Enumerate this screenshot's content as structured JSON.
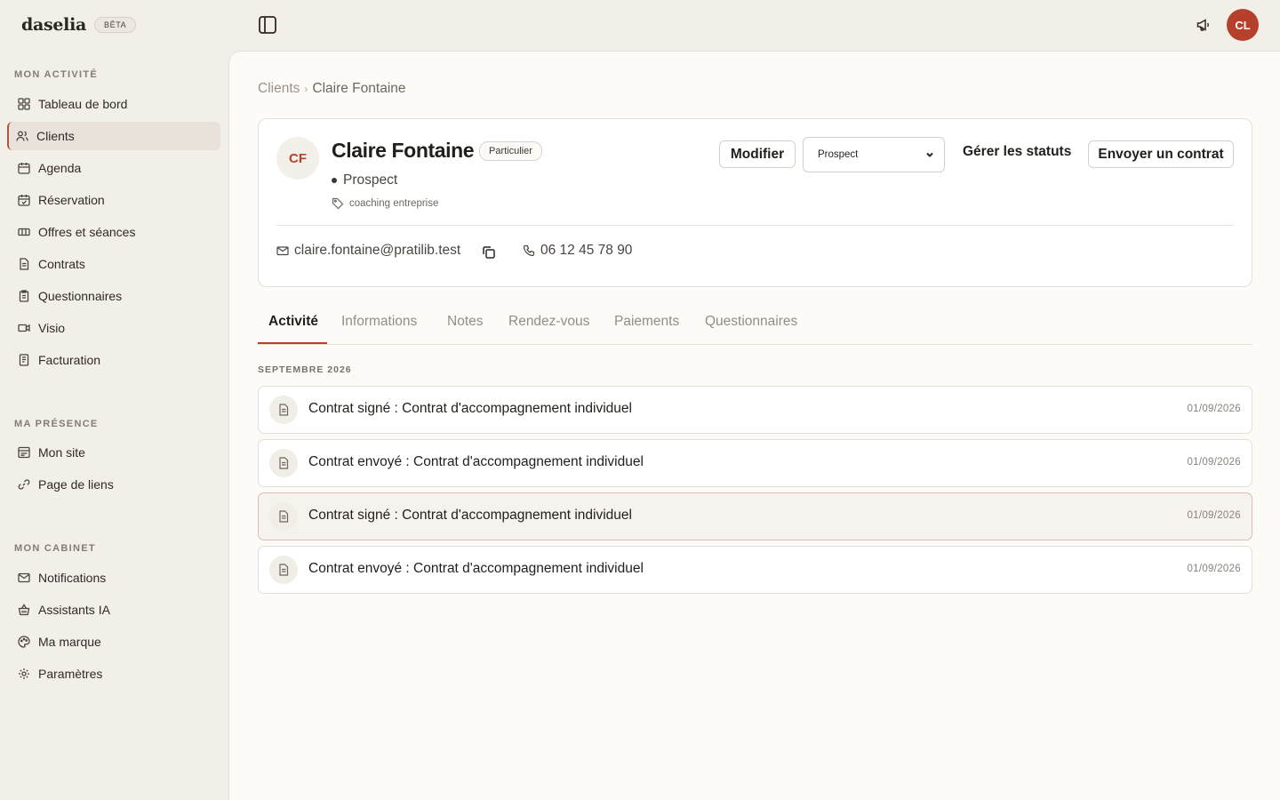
{
  "brand": {
    "name": "daselia",
    "badge": "BÊTA"
  },
  "sidebar": {
    "sections": [
      {
        "title": "MON ACTIVITÉ",
        "items": [
          {
            "label": "Tableau de bord",
            "icon": "grid-icon"
          },
          {
            "label": "Clients",
            "icon": "users-icon",
            "active": true
          },
          {
            "label": "Agenda",
            "icon": "calendar-icon"
          },
          {
            "label": "Réservation",
            "icon": "calendar-check-icon"
          },
          {
            "label": "Offres et séances",
            "icon": "ticket-icon"
          },
          {
            "label": "Contrats",
            "icon": "document-icon"
          },
          {
            "label": "Questionnaires",
            "icon": "clipboard-icon"
          },
          {
            "label": "Visio",
            "icon": "video-icon"
          },
          {
            "label": "Facturation",
            "icon": "invoice-icon"
          }
        ]
      },
      {
        "title": "MA PRÉSENCE",
        "items": [
          {
            "label": "Mon site",
            "icon": "site-icon"
          },
          {
            "label": "Page de liens",
            "icon": "link-icon"
          }
        ]
      },
      {
        "title": "MON CABINET",
        "items": [
          {
            "label": "Notifications",
            "icon": "mail-icon"
          },
          {
            "label": "Assistants IA",
            "icon": "basket-icon"
          },
          {
            "label": "Ma marque",
            "icon": "palette-icon"
          },
          {
            "label": "Paramètres",
            "icon": "gear-icon"
          }
        ]
      }
    ]
  },
  "topbar": {
    "user_initials": "CL"
  },
  "breadcrumb": {
    "parent": "Clients",
    "separator": "›",
    "current": "Claire Fontaine"
  },
  "client": {
    "initials": "CF",
    "name": "Claire Fontaine",
    "type": "Particulier",
    "status": "Prospect",
    "tag": "coaching entreprise",
    "email": "claire.fontaine@pratilib.test",
    "phone": "06 12 45 78 90"
  },
  "actions": {
    "edit": "Modifier",
    "status_select": "Prospect",
    "manage_statuses": "Gérer les statuts",
    "send_contract": "Envoyer un contrat"
  },
  "tabs": [
    "Activité",
    "Informations",
    "Notes",
    "Rendez-vous",
    "Paiements",
    "Questionnaires"
  ],
  "activity": {
    "month": "SEPTEMBRE 2026",
    "items": [
      {
        "title": "Contrat signé : Contrat d'accompagnement individuel",
        "date": "01/09/2026"
      },
      {
        "title": "Contrat envoyé : Contrat d'accompagnement individuel",
        "date": "01/09/2026"
      },
      {
        "title": "Contrat signé : Contrat d'accompagnement individuel",
        "date": "01/09/2026"
      },
      {
        "title": "Contrat envoyé : Contrat d'accompagnement individuel",
        "date": "01/09/2026"
      }
    ]
  },
  "colors": {
    "accent": "#b5412d",
    "sidebar_bg": "#f2efe9",
    "main_bg": "#fcfbf8"
  }
}
